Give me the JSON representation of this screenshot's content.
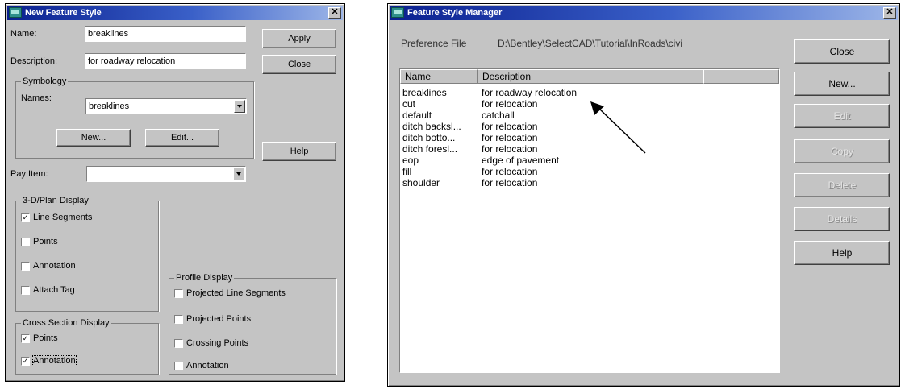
{
  "left_dialog": {
    "title": "New Feature Style",
    "name_label": "Name:",
    "name_value": "breaklines",
    "description_label": "Description:",
    "description_value": "for roadway relocation",
    "apply_label": "Apply",
    "close_label": "Close",
    "help_label": "Help",
    "symbology": {
      "title": "Symbology",
      "names_label": "Names:",
      "names_value": "breaklines",
      "new_label": "New...",
      "edit_label": "Edit..."
    },
    "pay_item_label": "Pay Item:",
    "pay_item_value": "",
    "plan_display": {
      "title": "3-D/Plan Display",
      "items": [
        {
          "label": "Line Segments",
          "checked": true
        },
        {
          "label": "Points",
          "checked": false
        },
        {
          "label": "Annotation",
          "checked": false
        },
        {
          "label": "Attach Tag",
          "checked": false
        }
      ]
    },
    "cross_section": {
      "title": "Cross Section Display",
      "items": [
        {
          "label": "Points",
          "checked": true
        },
        {
          "label": "Annotation",
          "checked": true
        }
      ]
    },
    "profile_display": {
      "title": "Profile Display",
      "items": [
        {
          "label": "Projected Line Segments",
          "checked": false
        },
        {
          "label": "Projected Points",
          "checked": false
        },
        {
          "label": "Crossing Points",
          "checked": false
        },
        {
          "label": "Annotation",
          "checked": false
        }
      ]
    }
  },
  "right_dialog": {
    "title": "Feature Style Manager",
    "pref_label": "Preference File",
    "pref_value": "D:\\Bentley\\SelectCAD\\Tutorial\\InRoads\\civi",
    "columns": [
      "Name",
      "Description"
    ],
    "rows": [
      {
        "name": "breaklines",
        "description": "for roadway relocation"
      },
      {
        "name": "cut",
        "description": "for relocation"
      },
      {
        "name": "default",
        "description": "catchall"
      },
      {
        "name": "ditch backsl...",
        "description": "for relocation"
      },
      {
        "name": "ditch botto...",
        "description": "for relocation"
      },
      {
        "name": "ditch foresl...",
        "description": "for relocation"
      },
      {
        "name": "eop",
        "description": "edge of pavement"
      },
      {
        "name": "fill",
        "description": "for relocation"
      },
      {
        "name": "shoulder",
        "description": "for relocation"
      }
    ],
    "buttons": [
      {
        "label": "Close",
        "enabled": true
      },
      {
        "label": "New...",
        "enabled": true
      },
      {
        "label": "Edit",
        "enabled": false
      },
      {
        "label": "Copy",
        "enabled": false
      },
      {
        "label": "Delete",
        "enabled": false
      },
      {
        "label": "Details",
        "enabled": false
      },
      {
        "label": "Help",
        "enabled": true
      }
    ]
  }
}
